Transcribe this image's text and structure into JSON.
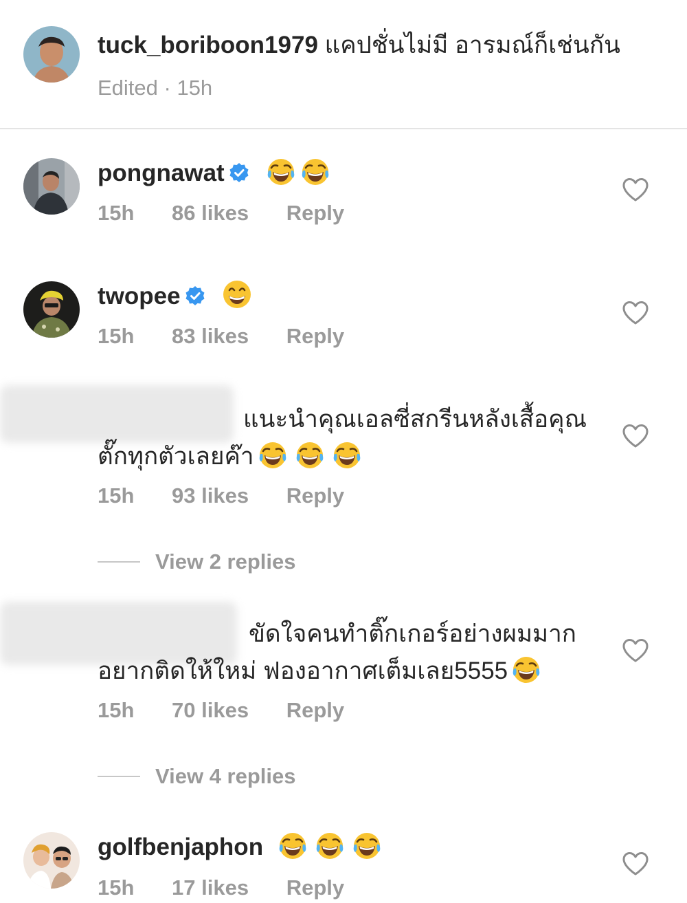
{
  "caption": {
    "username": "tuck_boriboon1979",
    "text": "แคปชั่นไม่มี อารมณ์ก็เช่นกัน",
    "meta": "Edited · 15h"
  },
  "comments": [
    {
      "username": "pongnawat",
      "verified": true,
      "text_line1": "",
      "text_line2": "",
      "time": "15h",
      "likes": "86 likes",
      "reply": "Reply"
    },
    {
      "username": "twopee",
      "verified": true,
      "text_line1": "",
      "text_line2": "",
      "time": "15h",
      "likes": "83 likes",
      "reply": "Reply"
    },
    {
      "username": "",
      "verified": false,
      "text_line1": "แนะนำคุณเอลซี่สกรีนหลังเสื้อคุณ",
      "text_line2": "ตั๊กทุกตัวเลยค๊า",
      "time": "15h",
      "likes": "93 likes",
      "reply": "Reply",
      "view_replies": "View 2 replies"
    },
    {
      "username": "",
      "verified": false,
      "text_line1": "ขัดใจคนทำติ๊กเกอร์อย่างผมมาก",
      "text_line2": "อยากติดให้ใหม่ ฟองอากาศเต็มเลย5555",
      "time": "15h",
      "likes": "70 likes",
      "reply": "Reply",
      "view_replies": "View 4 replies"
    },
    {
      "username": "golfbenjaphon",
      "verified": false,
      "text_line1": "",
      "text_line2": "",
      "time": "15h",
      "likes": "17 likes",
      "reply": "Reply"
    }
  ],
  "icons": {
    "heart": "heart-outline-icon",
    "verified": "verified-badge-icon",
    "emoji_laugh": "face-with-tears-of-joy-emoji",
    "emoji_grin": "beaming-face-emoji"
  },
  "colors": {
    "text": "#262626",
    "secondary": "#9a9a9a",
    "verified": "#3897f0",
    "divider": "#e4e4e4"
  }
}
